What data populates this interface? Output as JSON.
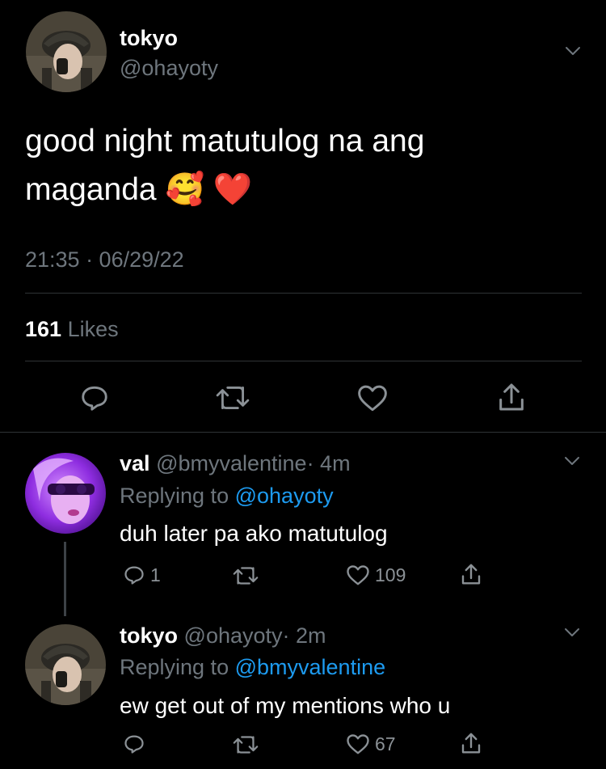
{
  "main_tweet": {
    "display_name": "tokyo",
    "handle": "@ohayoty",
    "text_line1": "good night matutulog na ang",
    "text_line2": "maganda 🥰 ❤️",
    "timestamp": "21:35 · 06/29/22",
    "likes_count": "161",
    "likes_label": "Likes"
  },
  "replies": [
    {
      "display_name": "val",
      "handle": "@bmyvalentine",
      "age": "· 4m",
      "replying_prefix": "Replying to",
      "replying_to": "@ohayoty",
      "text": "duh later pa ako matutulog",
      "reply_count": "1",
      "retweet_count": "",
      "like_count": "109"
    },
    {
      "display_name": "tokyo",
      "handle": "@ohayoty",
      "age": "· 2m",
      "replying_prefix": "Replying to",
      "replying_to": "@bmyvalentine",
      "text": "ew get out of my mentions who u",
      "reply_count": "",
      "retweet_count": "",
      "like_count": "67"
    }
  ],
  "colors": {
    "background": "#000000",
    "text": "#ffffff",
    "muted": "#6e767d",
    "link": "#1d9bf0",
    "divider": "#2f3336"
  }
}
